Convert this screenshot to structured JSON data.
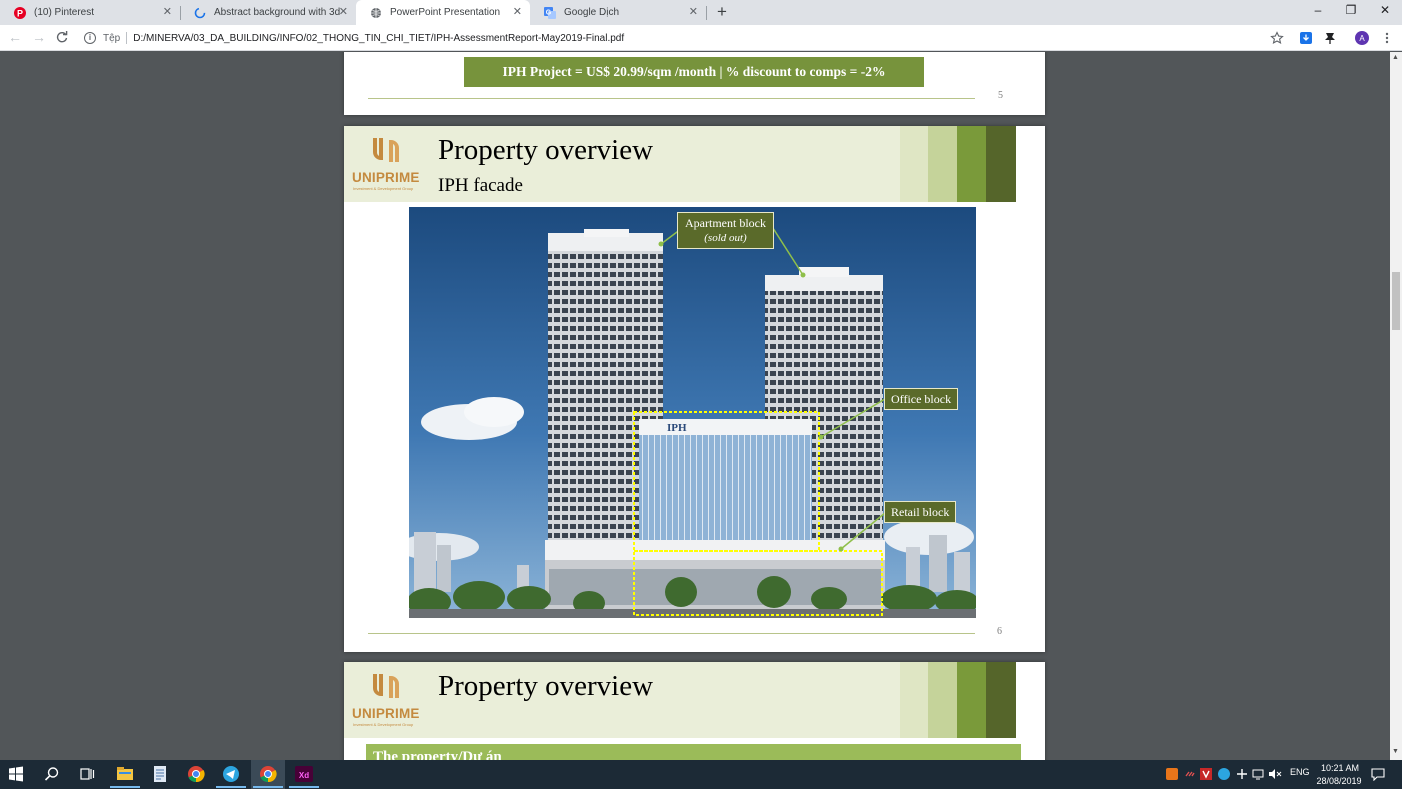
{
  "browser": {
    "tabs": [
      {
        "label": "(10) Pinterest",
        "icon": "pinterest-icon"
      },
      {
        "label": "Abstract background with 3d flui",
        "icon": "loading-icon"
      },
      {
        "label": "PowerPoint Presentation",
        "icon": "globe-icon",
        "active": true
      },
      {
        "label": "Google Dịch",
        "icon": "google-translate-icon"
      }
    ],
    "new_tab": "+",
    "window_controls": {
      "minimize": "–",
      "restore": "❐",
      "close": "✕"
    },
    "nav": {
      "back": "←",
      "forward": "→",
      "reload": "C"
    },
    "address": {
      "scheme_label": "Tệp",
      "url": "D:/MINERVA/03_DA_BUILDING/INFO/02_THONG_TIN_CHI_TIET/IPH-AssessmentReport-May2019-Final.pdf"
    },
    "profile_initial": "A"
  },
  "document": {
    "page5": {
      "banner": "IPH Project = US$ 20.99/sqm /month  |  % discount to comps = -2%",
      "page_number": "5"
    },
    "page6": {
      "logo": "UNIPRIME",
      "logo_sub": "Investment & Development Group",
      "title": "Property overview",
      "subtitle": "IPH facade",
      "building_sign": "IPH",
      "callouts": {
        "apartment": "Apartment block",
        "apartment_note": "(sold out)",
        "office": "Office block",
        "retail": "Retail block"
      },
      "page_number": "6"
    },
    "page7": {
      "logo": "UNIPRIME",
      "logo_sub": "Investment & Development Group",
      "title": "Property overview",
      "band_text": "The property/Dự án"
    }
  },
  "taskbar": {
    "tray": {
      "lang": "ENG",
      "time": "10:21 AM",
      "date": "28/08/2019"
    }
  },
  "colors": {
    "olive": "#7a9a3a",
    "dark_olive": "#55652a",
    "light_olive": "#c5d39a",
    "cream": "#eaeed9",
    "logo_gold": "#c48a3f"
  }
}
